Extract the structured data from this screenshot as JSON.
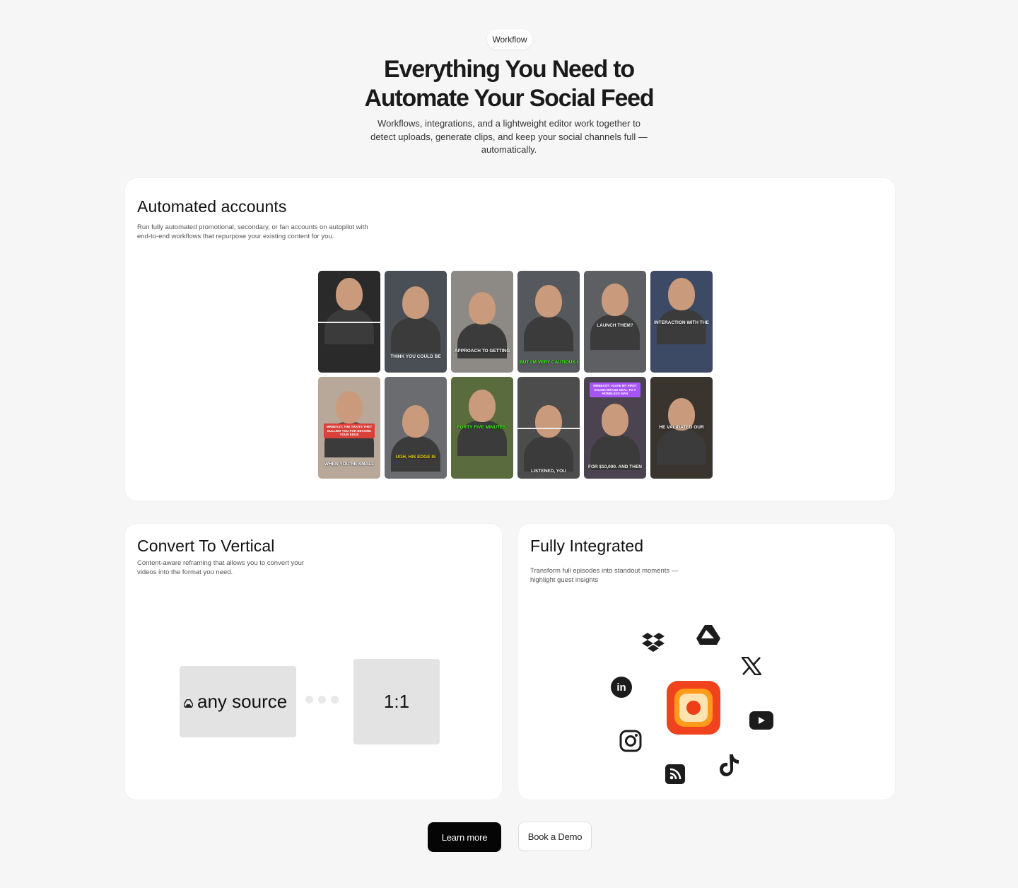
{
  "header": {
    "badge": "Workflow",
    "title_line1": "Everything You Need to",
    "title_line2": "Automate Your Social Feed",
    "subtitle": "Workflows, integrations, and a lightweight editor work together to detect uploads, generate clips, and keep your social channels full — automatically."
  },
  "automated": {
    "title": "Automated accounts",
    "description": "Run fully automated promotional, secondary, or fan accounts on autopilot with end-to-end workflows that repurpose your existing content for you.",
    "thumbnails": [
      {
        "caption": "",
        "highlight": ""
      },
      {
        "caption": "THINK YOU COULD BE",
        "highlight": "#7c3aed"
      },
      {
        "caption": "APPROACH TO GETTING",
        "highlight": "#7c3aed"
      },
      {
        "caption": "BUT I'M VERY CAUTIOUS OF",
        "highlight": "#39ff14"
      },
      {
        "caption": "LAUNCH THEM?",
        "highlight": ""
      },
      {
        "caption": "INTERACTION WITH THE",
        "highlight": ""
      },
      {
        "caption": "When you're small",
        "highlight": ""
      },
      {
        "caption": "Ugh, his edge is",
        "highlight": "#f5d90a"
      },
      {
        "caption": "FORTY FIVE MINUTES.",
        "highlight": "#39ff14"
      },
      {
        "caption": "LISTENED, YOU",
        "highlight": ""
      },
      {
        "caption": "FOR $10,000. AND THEN",
        "highlight": "#a855f7"
      },
      {
        "caption": "HE VALIDATED OUR",
        "highlight": ""
      }
    ],
    "overlay_labels": {
      "thumb7": "MRBEAST: THE TRAITS THEY BULLIED YOU FOR BECOME YOUR EDGE",
      "thumb11": "MRBEAST: I GAVE MY FIRST $10,000 BRAND DEAL TO A HOMELESS MAN"
    }
  },
  "convert": {
    "title": "Convert To Vertical",
    "description": "Content-aware reframing that allows you to convert your videos into the format you need.",
    "source_label": "any source",
    "ratio_label": "1:1"
  },
  "integrated": {
    "title": "Fully Integrated",
    "description": "Transform full episodes into standout moments — highlight guest insights",
    "icons": [
      "dropbox-icon",
      "google-drive-icon",
      "x-icon",
      "linkedin-icon",
      "youtube-icon",
      "instagram-icon",
      "tiktok-icon",
      "rss-icon"
    ],
    "hub_color": "#f0421c"
  },
  "actions": {
    "primary": "Learn more",
    "secondary": "Book a Demo"
  }
}
